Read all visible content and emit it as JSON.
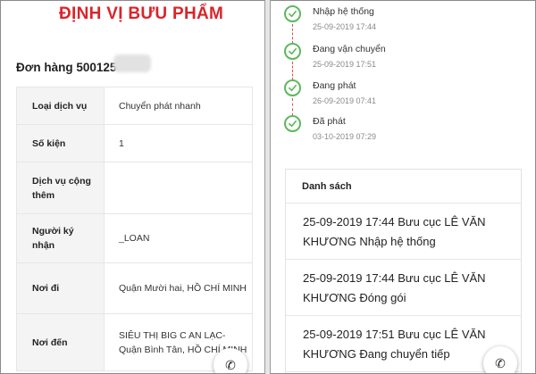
{
  "left": {
    "title": "ĐỊNH VỊ BƯU PHẨM",
    "order_label": "Đơn hàng 500125",
    "rows": [
      {
        "key": "Loại dịch vụ",
        "value": "Chuyển phát nhanh"
      },
      {
        "key": "Số kiện",
        "value": "1"
      },
      {
        "key": "Dịch vụ cộng thêm",
        "value": ""
      },
      {
        "key": "Người ký nhận",
        "value": "_LOAN"
      },
      {
        "key": "Nơi đi",
        "value": "Quận Mười hai, HỒ CHÍ MINH"
      },
      {
        "key": "Nơi đến",
        "value": "SIÊU THỊ BIG C AN LẠC-Quận Bình Tân, HỒ CHÍ MINH"
      }
    ]
  },
  "right": {
    "timeline": [
      {
        "label": "Nhập hệ thống",
        "time": "25-09-2019 17:44"
      },
      {
        "label": "Đang vận chuyển",
        "time": "25-09-2019 17:51"
      },
      {
        "label": "Đang phát",
        "time": "26-09-2019 07:41"
      },
      {
        "label": "Đã phát",
        "time": "03-10-2019 07:29"
      }
    ],
    "list_title": "Danh sách",
    "list_items": [
      {
        "text": "25-09-2019 17:44 Bưu cục LÊ VĂN KHƯƠNG Nhập hệ thống"
      },
      {
        "text": "25-09-2019 17:44 Bưu cục LÊ VĂN KHƯƠNG Đóng gói"
      },
      {
        "text": "25-09-2019 17:51 Bưu cục LÊ VĂN KHƯƠNG Đang chuyển tiếp"
      }
    ]
  },
  "icons": {
    "call": "phone-icon",
    "status": "check-circle-icon"
  },
  "colors": {
    "title": "#d9252a",
    "check": "#5cb85c",
    "timeline_line": "#d9534f"
  }
}
